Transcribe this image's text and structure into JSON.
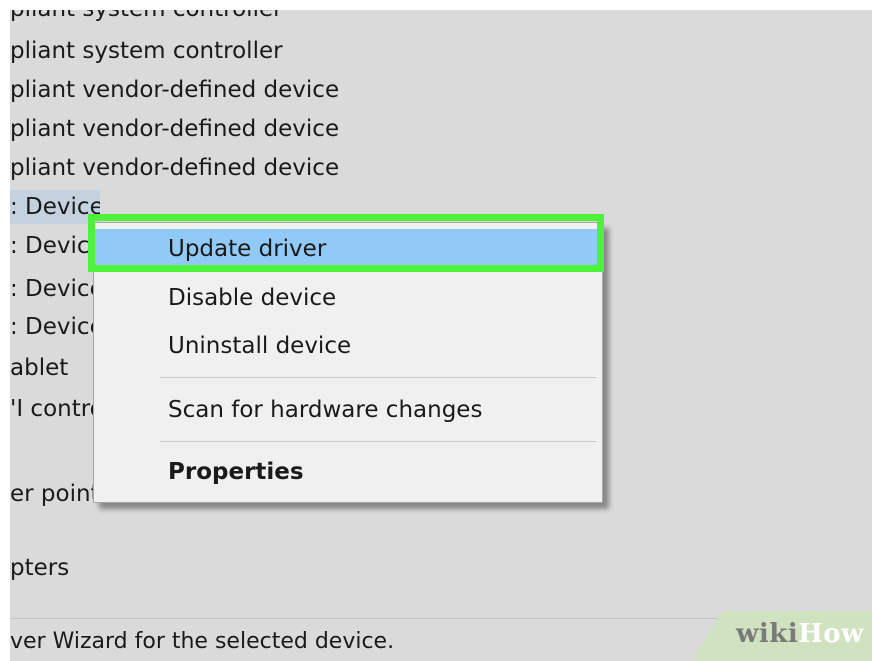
{
  "device_tree": {
    "items": [
      "pliant system controller",
      "pliant system controller",
      "pliant vendor-defined device",
      "pliant vendor-defined device",
      "pliant vendor-defined device",
      ": Device",
      ": Device",
      ": Device",
      ": Device",
      "ablet",
      "'I controller",
      "er pointing device",
      "pters"
    ]
  },
  "context_menu": {
    "items": [
      "Update driver",
      "Disable device",
      "Uninstall device",
      "Scan for hardware changes",
      "Properties"
    ]
  },
  "status_bar": {
    "text": "ver Wizard for the selected device."
  },
  "watermark": {
    "wiki": "wiki",
    "how": "How"
  },
  "colors": {
    "highlight_border": "#4ff23a",
    "menu_hover": "#91c9f7",
    "selection": "#c4d2df",
    "background": "#dadada"
  }
}
